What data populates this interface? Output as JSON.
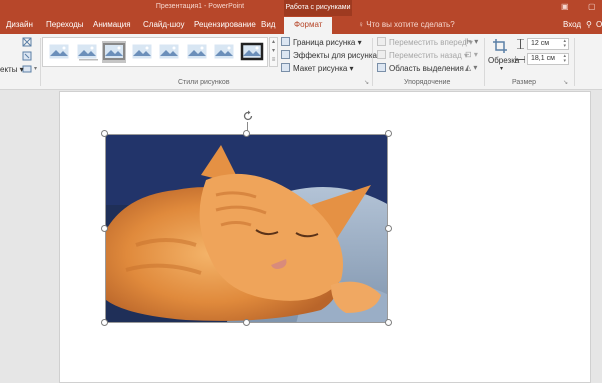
{
  "titlebar": {
    "title": "Презентация1 - PowerPoint",
    "context_tab_group": "Работа с рисунками",
    "restore_icon": "restore-icon",
    "close_icon": "close-icon"
  },
  "tabs": [
    {
      "label": "Дизайн"
    },
    {
      "label": "Переходы"
    },
    {
      "label": "Анимация"
    },
    {
      "label": "Слайд-шоу"
    },
    {
      "label": "Рецензирование"
    },
    {
      "label": "Вид"
    },
    {
      "label": "Формат",
      "active": true
    }
  ],
  "tellme": {
    "label": "Что вы хотите сделать?",
    "icon": "lightbulb-icon"
  },
  "account": {
    "signin": "Вход",
    "share_icon": "share-user-icon",
    "share_label": "О"
  },
  "ribbon": {
    "adjust": {
      "partial_label": "екты"
    },
    "styles": {
      "group_label": "Стили рисунков",
      "gallery_count": 8,
      "selected_index": 2,
      "border_label": "Граница рисунка",
      "effects_label": "Эффекты для рисунка",
      "layout_label": "Макет рисунка"
    },
    "arrange": {
      "group_label": "Упорядочение",
      "bring_forward": "Переместить вперед",
      "send_backward": "Переместить назад",
      "selection_pane": "Область выделения"
    },
    "size": {
      "group_label": "Размер",
      "crop_label": "Обрезка",
      "height_value": "12 см",
      "width_value": "18,1 см"
    }
  },
  "colors": {
    "accent": "#b7472a",
    "accent_dark": "#9e3a20",
    "ribbon_bg": "#f3f3f3"
  }
}
